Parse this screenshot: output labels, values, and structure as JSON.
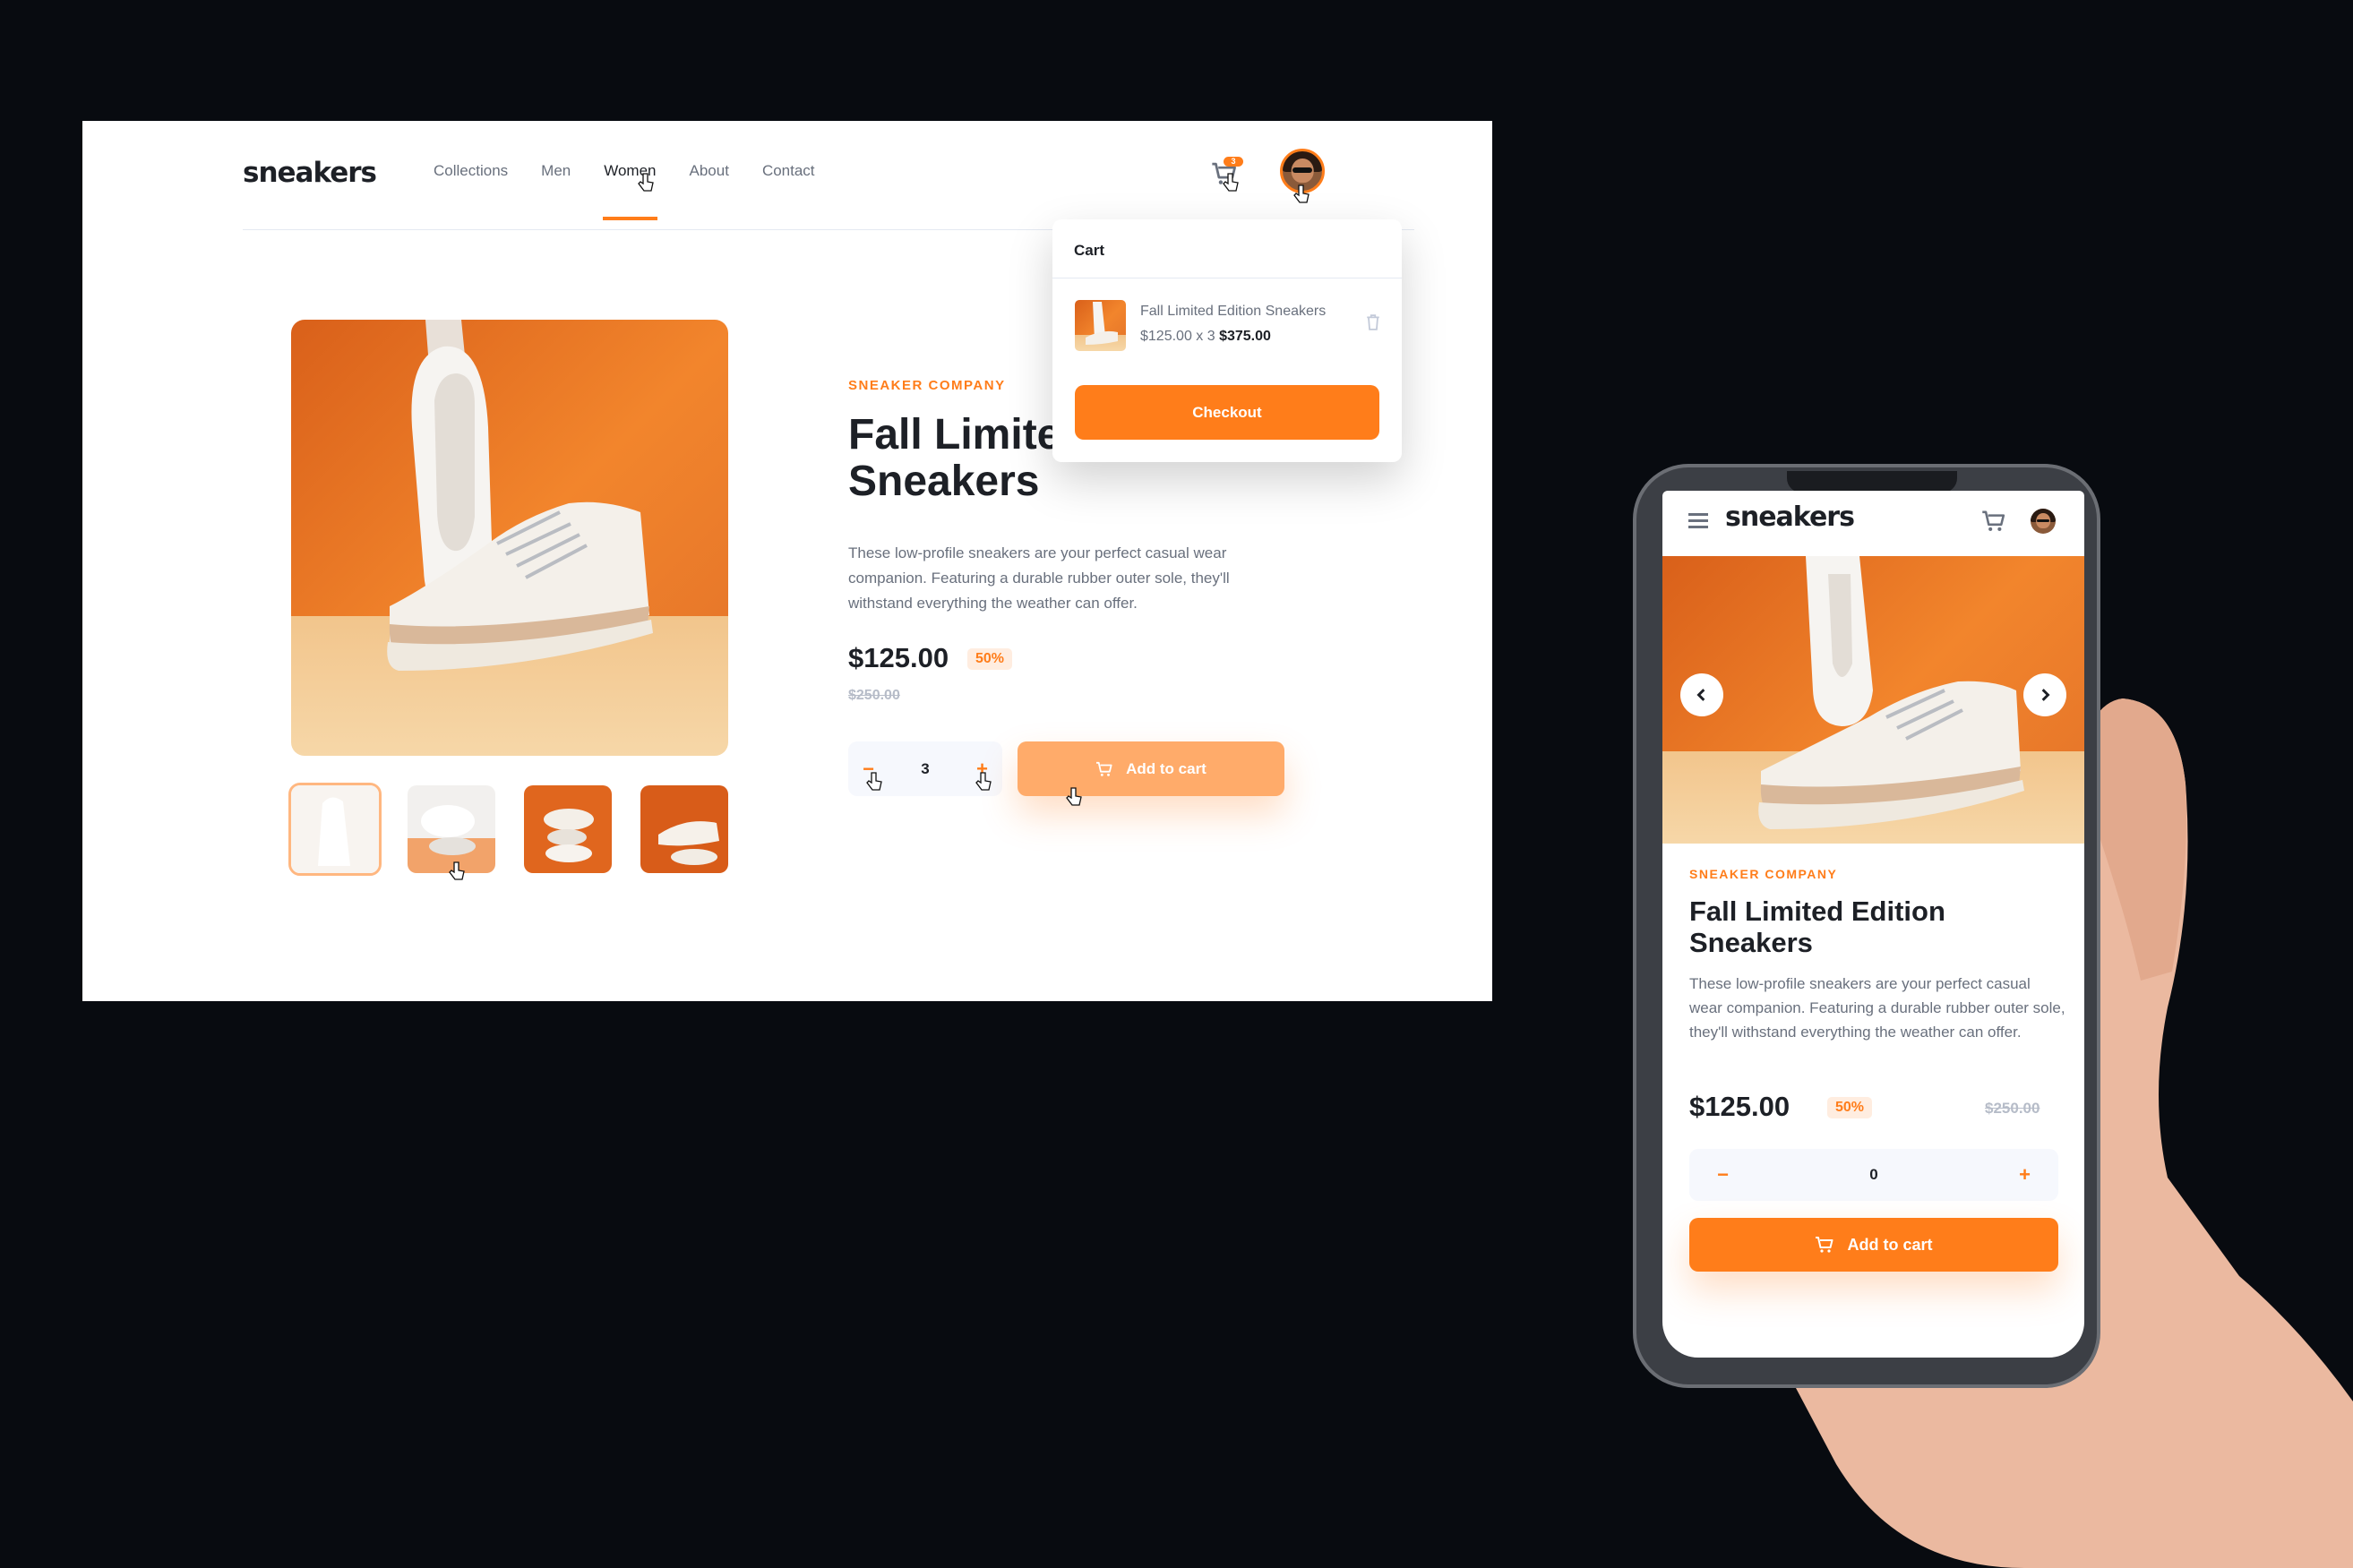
{
  "brand": "sneakers",
  "nav": [
    "Collections",
    "Men",
    "Women",
    "About",
    "Contact"
  ],
  "active_nav": "Women",
  "cart": {
    "count": "3",
    "title": "Cart",
    "item_name": "Fall Limited Edition Sneakers",
    "item_price_qty": "$125.00 x 3",
    "item_total": "$375.00",
    "checkout_label": "Checkout"
  },
  "product": {
    "company": "SNEAKER COMPANY",
    "title": "Fall Limited Edition Sneakers",
    "desktop_title_visible": "Fall Limite",
    "desktop_title_line2": "Sneakers",
    "description": "These low-profile sneakers are your perfect casual wear companion. Featuring a durable rubber outer sole, they'll withstand everything the weather can offer.",
    "price": "$125.00",
    "discount": "50%",
    "original_price": "$250.00",
    "add_to_cart_label": "Add to cart"
  },
  "desktop": {
    "quantity": "3",
    "minus_symbol": "−",
    "plus_symbol": "+"
  },
  "mobile": {
    "quantity": "0",
    "minus_symbol": "−",
    "plus_symbol": "+"
  },
  "colors": {
    "accent": "#ff7d1a",
    "accent_pale": "#ffede0",
    "dark_text": "#1d2026",
    "muted_text": "#69707d",
    "background": "#080b10"
  }
}
